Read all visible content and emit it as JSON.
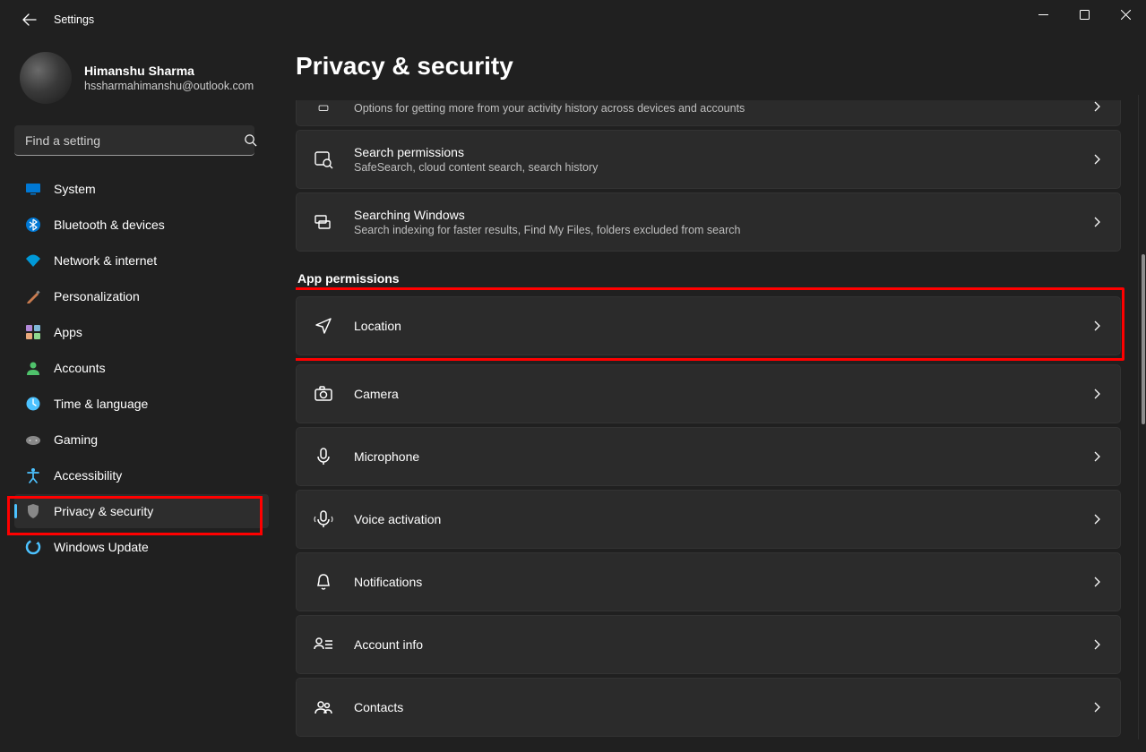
{
  "window": {
    "title": "Settings"
  },
  "user": {
    "name": "Himanshu Sharma",
    "email": "hssharmahimanshu@outlook.com"
  },
  "search": {
    "placeholder": "Find a setting"
  },
  "sidebar": {
    "items": [
      {
        "label": "System"
      },
      {
        "label": "Bluetooth & devices"
      },
      {
        "label": "Network & internet"
      },
      {
        "label": "Personalization"
      },
      {
        "label": "Apps"
      },
      {
        "label": "Accounts"
      },
      {
        "label": "Time & language"
      },
      {
        "label": "Gaming"
      },
      {
        "label": "Accessibility"
      },
      {
        "label": "Privacy & security"
      },
      {
        "label": "Windows Update"
      }
    ]
  },
  "page": {
    "title": "Privacy & security"
  },
  "cards": {
    "activity_sub": "Options for getting more from your activity history across devices and accounts",
    "search_perm_title": "Search permissions",
    "search_perm_sub": "SafeSearch, cloud content search, search history",
    "search_win_title": "Searching Windows",
    "search_win_sub": "Search indexing for faster results, Find My Files, folders excluded from search"
  },
  "section": {
    "label": "App permissions"
  },
  "permissions": {
    "location": "Location",
    "camera": "Camera",
    "microphone": "Microphone",
    "voice": "Voice activation",
    "notifications": "Notifications",
    "account_info": "Account info",
    "contacts": "Contacts"
  }
}
